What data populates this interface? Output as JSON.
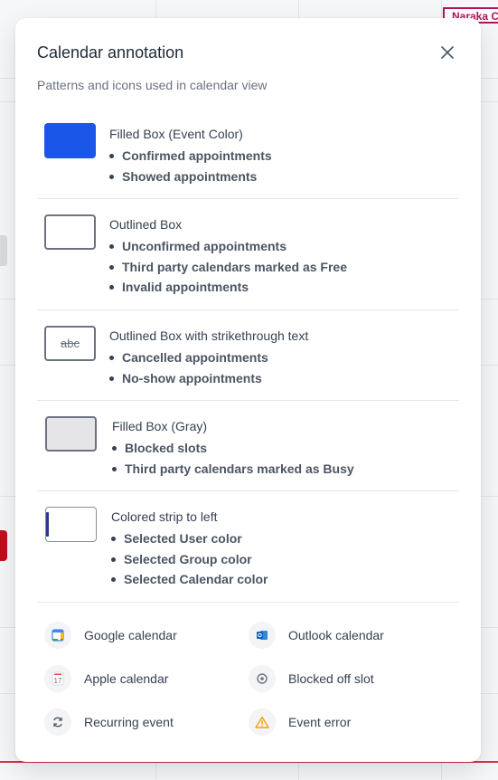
{
  "modal": {
    "title": "Calendar annotation",
    "subtitle": "Patterns and icons used in calendar view",
    "close_icon": "close-icon"
  },
  "legend": [
    {
      "label": "Filled Box (Event Color)",
      "items": [
        "Confirmed appointments",
        "Showed appointments"
      ],
      "swatch": "filled",
      "color": "#1a56e8"
    },
    {
      "label": "Outlined Box",
      "items": [
        "Unconfirmed appointments",
        "Third party calendars marked as Free",
        "Invalid appointments"
      ],
      "swatch": "outlined"
    },
    {
      "label": "Outlined Box with strikethrough text",
      "items": [
        "Cancelled appointments",
        "No-show appointments"
      ],
      "swatch": "strikethrough",
      "swatch_text": "abc"
    },
    {
      "label": "Filled Box (Gray)",
      "items": [
        "Blocked slots",
        "Third party calendars marked as Busy"
      ],
      "swatch": "gray",
      "color": "#e5e5e7"
    },
    {
      "label": "Colored strip to left",
      "items": [
        "Selected User color",
        "Selected Group color",
        "Selected Calendar color"
      ],
      "swatch": "strip",
      "color": "#2b3790"
    }
  ],
  "icons": [
    {
      "label": "Google calendar",
      "icon": "google-calendar-icon"
    },
    {
      "label": "Outlook calendar",
      "icon": "outlook-calendar-icon"
    },
    {
      "label": "Apple calendar",
      "icon": "apple-calendar-icon",
      "icon_text": "17"
    },
    {
      "label": "Blocked off slot",
      "icon": "blocked-slot-icon"
    },
    {
      "label": "Recurring event",
      "icon": "recurring-event-icon"
    },
    {
      "label": "Event error",
      "icon": "warning-icon"
    }
  ],
  "background": {
    "event_label": "Naraka C"
  }
}
